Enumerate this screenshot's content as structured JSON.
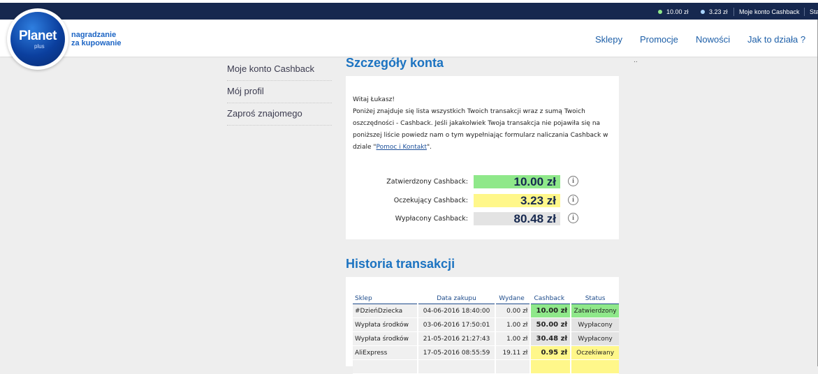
{
  "topbar": {
    "approved_amount": "10.00 zł",
    "pending_amount": "3.23 zł",
    "account_link": "Moje konto Cashback",
    "status_cut": "Statu"
  },
  "colors": {
    "approved": "#8fe88a",
    "pending": "#fff78a",
    "paid": "#e3e3e3",
    "brand_blue": "#1c73c1",
    "topbar": "#16284f"
  },
  "logo": {
    "word": "Planet",
    "plus": "plus",
    "tagline_line1": "nagradzanie",
    "tagline_line2": "za kupowanie"
  },
  "nav": {
    "shops": "Sklepy",
    "promotions": "Promocje",
    "news": "Nowości",
    "how": "Jak to działa ?"
  },
  "sidebar": {
    "items": [
      {
        "label": "Moje konto Cashback"
      },
      {
        "label": "Mój profil"
      },
      {
        "label": "Zaproś znajomego"
      }
    ]
  },
  "account": {
    "title": "Szczegóły konta",
    "greeting": "Witaj Łukasz!",
    "intro_text": "Poniżej znajduje się lista wszystkich Twoich transakcji wraz z sumą Twoich oszczędności - Cashback. Jeśli jakakolwiek Twoja transakcja nie pojawiła się na poniższej liście powiedz nam o tym wypełniając formularz naliczania Cashback w dziale \"",
    "help_link": "Pomoc i Kontakt",
    "intro_end": "\".",
    "approved_label": "Zatwierdzony Cashback:",
    "approved_value": "10.00 zł",
    "pending_label": "Oczekujący Cashback:",
    "pending_value": "3.23 zł",
    "paid_label": "Wypłacony Cashback:",
    "paid_value": "80.48 zł"
  },
  "history": {
    "title": "Historia transakcji",
    "columns": {
      "shop": "Sklep",
      "date": "Data zakupu",
      "spent": "Wydane",
      "cashback": "Cashback",
      "status": "Status"
    },
    "rows": [
      {
        "shop": "#DzieńDziecka",
        "date": "04-06-2016 18:40:00",
        "spent": "0.00 zł",
        "cashback": "10.00 zł",
        "status": "Zatwierdzony"
      },
      {
        "shop": "Wypłata środków",
        "date": "03-06-2016 17:50:01",
        "spent": "1.00 zł",
        "cashback": "50.00 zł",
        "status": "Wypłacony"
      },
      {
        "shop": "Wypłata środków",
        "date": "21-05-2016 21:27:43",
        "spent": "1.00 zł",
        "cashback": "30.48 zł",
        "status": "Wypłacony"
      },
      {
        "shop": "AliExpress",
        "date": "17-05-2016 08:55:59",
        "spent": "19.11 zł",
        "cashback": "0.95 zł",
        "status": "Oczekiwany"
      }
    ]
  },
  "right_dots": ".."
}
